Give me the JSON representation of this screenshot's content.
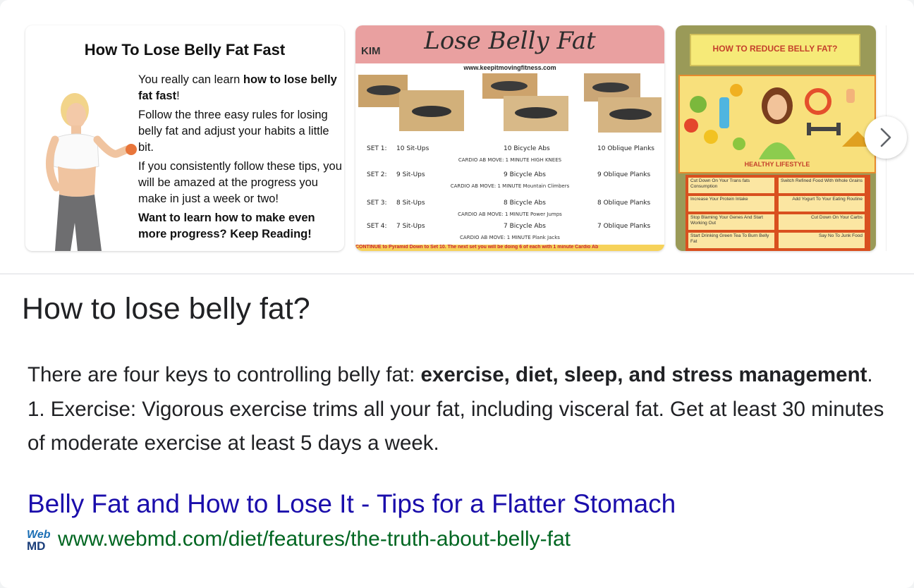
{
  "carousel": {
    "card1": {
      "title": "How To Lose Belly Fat Fast",
      "p1_pre": "You really can learn ",
      "p1_bold": "how to lose belly fat fast",
      "p1_post": "!",
      "p2": "Follow the three easy rules for losing belly fat and adjust your habits a little bit.",
      "p3": "If you consistently follow these tips, you will be amazed at the progress you make in just a week or two!",
      "p4": "Want to learn how to make even more progress?  Keep Reading!"
    },
    "card2": {
      "title": "Lose Belly Fat",
      "logo": "KIM",
      "url": "www.keepitmovingfitness.com",
      "sets": [
        {
          "set": "SET 1:",
          "a": "10 Sit-Ups",
          "b": "10 Bicycle Abs",
          "c": "10 Oblique Planks",
          "cardio": "CARDIO AB MOVE: 1 MINUTE  HIGH KNEES"
        },
        {
          "set": "SET 2:",
          "a": "9 Sit-Ups",
          "b": "9 Bicycle Abs",
          "c": "9 Oblique Planks",
          "cardio": "CARDIO AB MOVE: 1 MINUTE  Mountain Climbers"
        },
        {
          "set": "SET 3:",
          "a": "8 Sit-Ups",
          "b": "8 Bicycle Abs",
          "c": "8 Oblique Planks",
          "cardio": "CARDIO AB MOVE: 1 MINUTE  Power Jumps"
        },
        {
          "set": "SET 4:",
          "a": "7 Sit-Ups",
          "b": "7 Bicycle Abs",
          "c": "7 Oblique Planks",
          "cardio": "CARDIO AB MOVE: 1 MINUTE  Plank Jacks"
        }
      ],
      "footer": "CONTINUE to Pyramid Down to Set 10. The next set you will be doing 6 of each with 1 minute Cardio Ab"
    },
    "card3": {
      "title": "HOW TO REDUCE BELLY FAT?",
      "healthy": "HEALTHY LIFESTYLE",
      "tips": [
        "Cut Down On Your Trans fats Consumption",
        "Switch Refined Food With Whole Grains",
        "Increase Your Protein Intake",
        "Add Yogurt To Your Eating Routine",
        "Stop Blaming Your Genes And Start Working Out",
        "Cut Down On Your Carbs",
        "Start Drinking Green Tea To Burn Belly Fat",
        "Say No To Junk Food"
      ]
    },
    "next_icon": "chevron-right-icon"
  },
  "question": "How to lose belly fat?",
  "answer": {
    "pre": "There are four keys to controlling belly fat: ",
    "bold1": "exercise, diet, sleep, and stress management",
    "post": ". 1. Exercise: Vigorous exercise trims all your fat, including visceral fat. Get at least 30 minutes of moderate exercise at least 5 days a week."
  },
  "result": {
    "title": "Belly Fat and How to Lose It - Tips for a Flatter Stomach",
    "favicon_top": "Web",
    "favicon_bottom": "MD",
    "url": "www.webmd.com/diet/features/the-truth-about-belly-fat"
  },
  "colors": {
    "link": "#1a0dab",
    "url": "#006621",
    "text": "#202124"
  }
}
